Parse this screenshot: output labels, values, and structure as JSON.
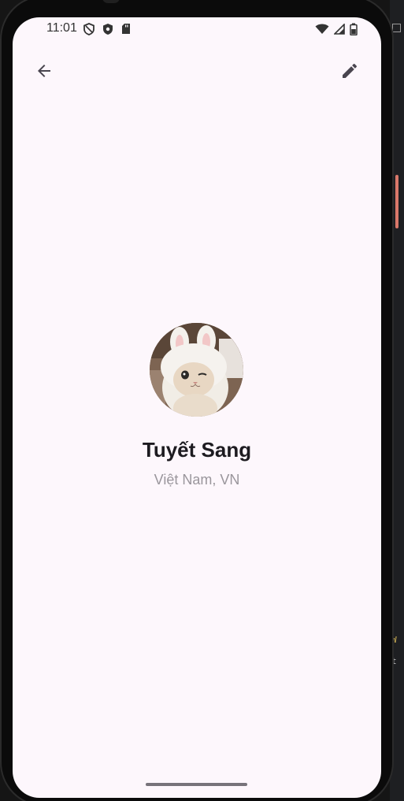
{
  "status_bar": {
    "time": "11:01",
    "left_icons": [
      "shield-outline-icon",
      "shield-check-icon",
      "sd-card-icon"
    ],
    "right_icons": [
      "wifi-icon",
      "signal-icon",
      "battery-icon"
    ]
  },
  "app_bar": {
    "back_icon": "arrow-back-icon",
    "edit_icon": "pencil-icon"
  },
  "profile": {
    "avatar": "cat-in-bunny-hat-photo",
    "name": "Tuyết Sang",
    "location": "Việt Nam, VN"
  },
  "ide_strip": {
    "fragment_1": "W",
    "fragment_2": "t"
  },
  "colors": {
    "screen_background": "#fdf7fc",
    "name_text": "#1d1b20",
    "location_text": "#9a969c",
    "icon": "#49454f"
  }
}
